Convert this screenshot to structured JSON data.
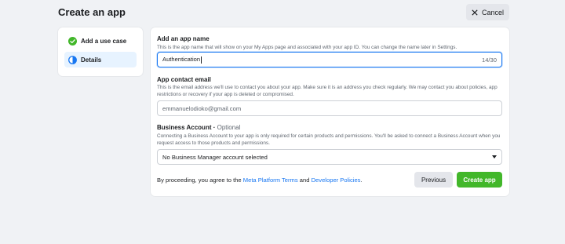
{
  "header": {
    "title": "Create an app",
    "cancel_label": "Cancel"
  },
  "steps": [
    {
      "label": "Add a use case",
      "status": "complete",
      "icon": "check-circle-icon"
    },
    {
      "label": "Details",
      "status": "active",
      "icon": "half-circle-icon"
    }
  ],
  "form": {
    "app_name": {
      "label": "Add an app name",
      "help": "This is the app name that will show on your My Apps page and associated with your app ID. You can change the name later in Settings.",
      "value": "Authentication",
      "counter": "14/30"
    },
    "contact_email": {
      "label": "App contact email",
      "help": "This is the email address we'll use to contact you about your app. Make sure it is an address you check regularly. We may contact you about policies, app restrictions or recovery if your app is deleted or compromised.",
      "value": "emmanuelodioko@gmail.com"
    },
    "business_account": {
      "label": "Business Account · ",
      "optional": "Optional",
      "help": "Connecting a Business Account to your app is only required for certain products and permissions. You'll be asked to connect a Business Account when you request access to those products and permissions.",
      "selected": "No Business Manager account selected"
    }
  },
  "footer": {
    "agree_prefix": "By proceeding, you agree to the ",
    "terms_link": "Meta Platform Terms",
    "and": " and ",
    "policies_link": "Developer Policies",
    "suffix": ".",
    "previous_label": "Previous",
    "create_label": "Create app"
  },
  "colors": {
    "accent": "#1877f2",
    "success": "#42b72a",
    "background": "#f0f2f5"
  }
}
